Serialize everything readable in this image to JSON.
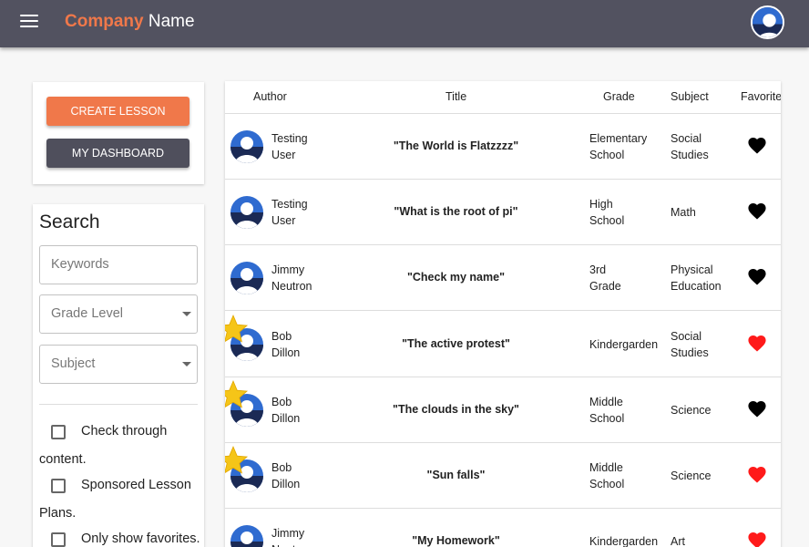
{
  "header": {
    "brand_accent": "Company",
    "brand_rest": " Name"
  },
  "sidebar": {
    "create_label": "Create Lesson",
    "dashboard_label": "My Dashboard",
    "search_title": "Search",
    "keywords_placeholder": "Keywords",
    "grade_label": "Grade Level",
    "subject_label": "Subject",
    "checkboxes": [
      {
        "label": "Check through content."
      },
      {
        "label": "Sponsored Lesson Plans."
      },
      {
        "label": "Only show favorites."
      }
    ]
  },
  "table": {
    "columns": [
      "Author",
      "Title",
      "Grade",
      "Subject",
      "Favorite"
    ],
    "rows": [
      {
        "author_first": "Testing",
        "author_last": "User",
        "title": "\"The World is Flatzzzz\"",
        "grade1": "Elementary",
        "grade2": "School",
        "subject1": "Social",
        "subject2": "Studies",
        "favorite": false,
        "sponsored": false
      },
      {
        "author_first": "Testing",
        "author_last": "User",
        "title": "\"What is the root of pi\"",
        "grade1": "High",
        "grade2": "School",
        "subject1": "Math",
        "subject2": "",
        "favorite": false,
        "sponsored": false
      },
      {
        "author_first": "Jimmy",
        "author_last": "Neutron",
        "title": "\"Check my name\"",
        "grade1": "3rd",
        "grade2": "Grade",
        "subject1": "Physical",
        "subject2": "Education",
        "favorite": false,
        "sponsored": false
      },
      {
        "author_first": "Bob",
        "author_last": "Dillon",
        "title": "\"The active protest\"",
        "grade1": "Kindergarden",
        "grade2": "",
        "subject1": "Social",
        "subject2": "Studies",
        "favorite": true,
        "sponsored": true
      },
      {
        "author_first": "Bob",
        "author_last": "Dillon",
        "title": "\"The clouds in the sky\"",
        "grade1": "Middle",
        "grade2": "School",
        "subject1": "Science",
        "subject2": "",
        "favorite": false,
        "sponsored": true
      },
      {
        "author_first": "Bob",
        "author_last": "Dillon",
        "title": "\"Sun falls\"",
        "grade1": "Middle",
        "grade2": "School",
        "subject1": "Science",
        "subject2": "",
        "favorite": true,
        "sponsored": true
      },
      {
        "author_first": "Jimmy",
        "author_last": "Neutron",
        "title": "\"My Homework\"",
        "grade1": "Kindergarden",
        "grade2": "",
        "subject1": "Art",
        "subject2": "",
        "favorite": true,
        "sponsored": false
      }
    ]
  },
  "colors": {
    "appbar": "#525260",
    "accent": "#f0784a",
    "dashboard_button": "#4f4f5c",
    "favorite_on": "#ff1a1a",
    "favorite_off": "#000000",
    "star": "#f5c518"
  },
  "icons": {
    "menu": "hamburger-icon",
    "avatar": "user-avatar-icon",
    "favorite": "heart-icon",
    "sponsored": "star-icon"
  }
}
